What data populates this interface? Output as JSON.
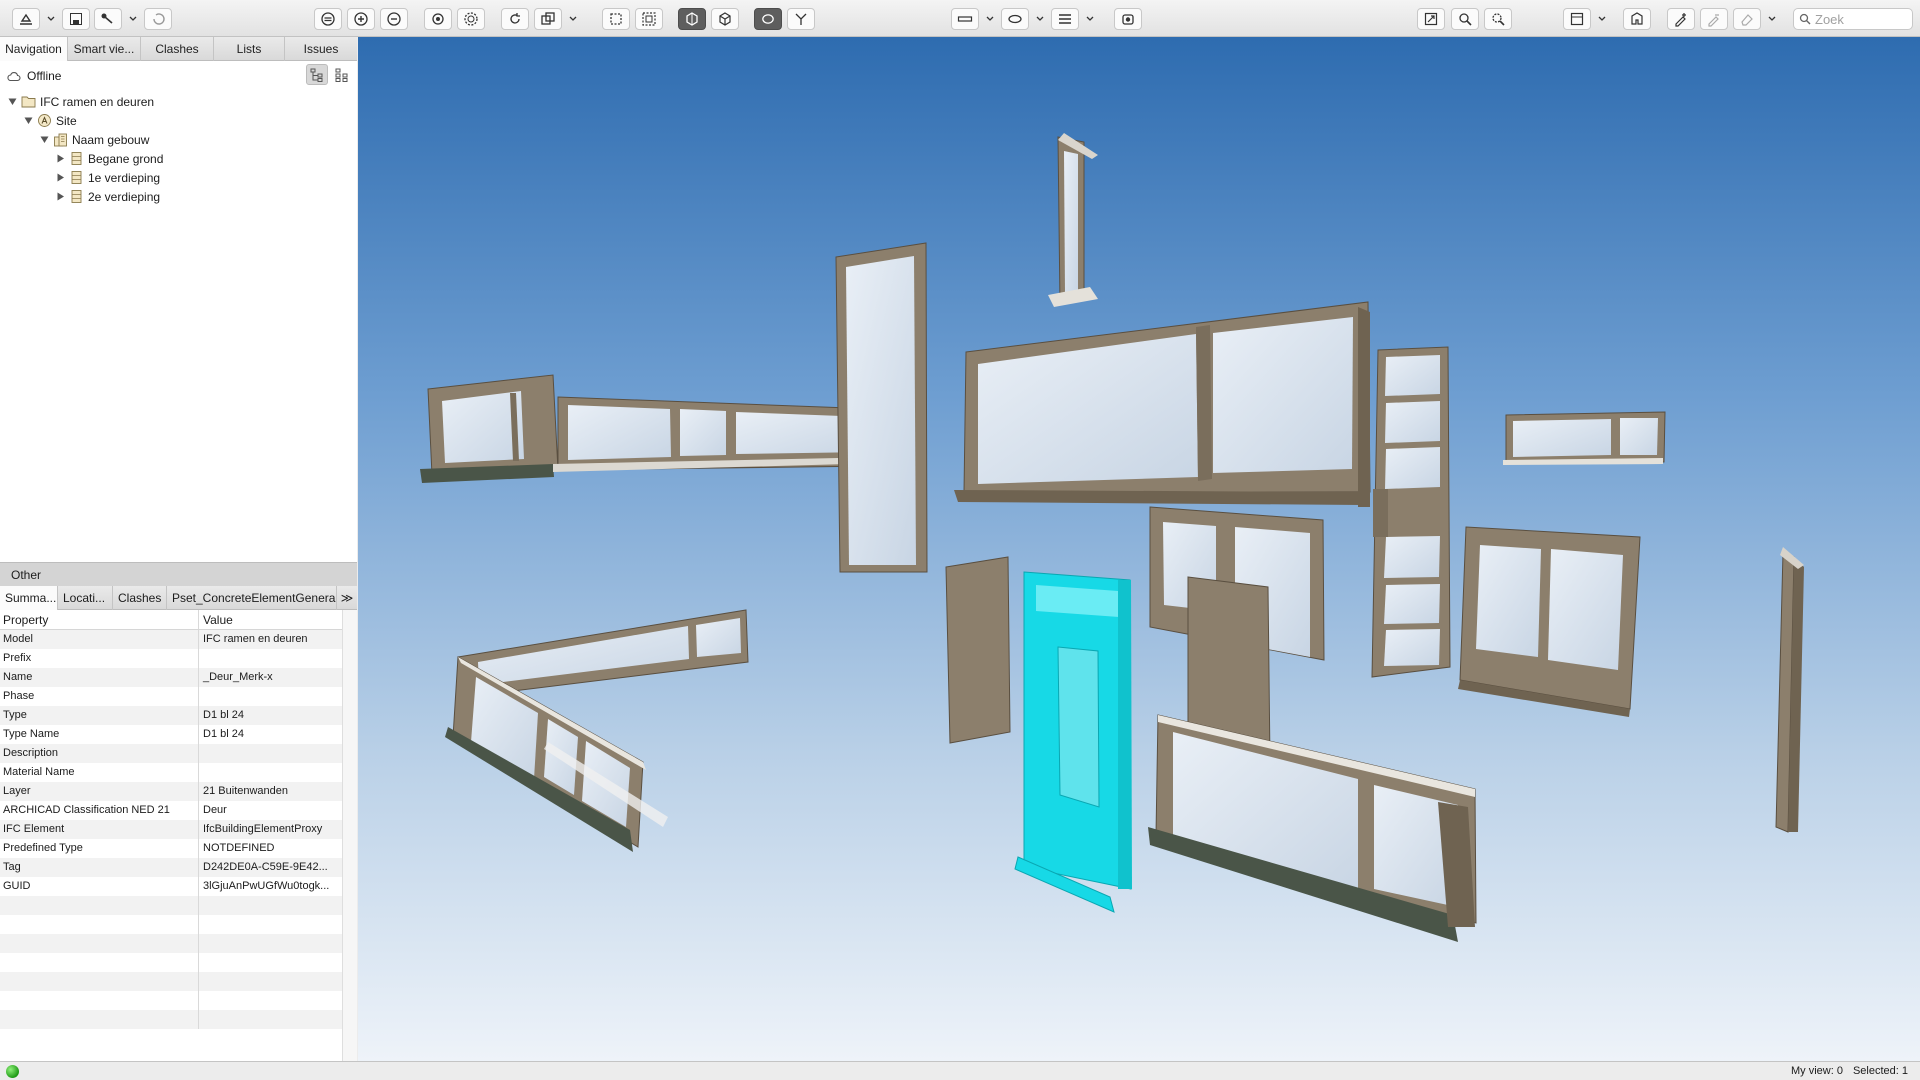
{
  "toolbar": {
    "search_placeholder": "Zoek",
    "buttons": [
      "open-icon",
      "save-icon",
      "measure-icon",
      "undo-icon",
      "hide-icon",
      "zoom-in-icon",
      "zoom-out-icon",
      "target-icon",
      "target-all-icon",
      "rotate-icon",
      "copy-icon",
      "frame-icon",
      "frames-icon",
      "section-box-icon",
      "cube-icon",
      "orbit-icon",
      "fly-icon",
      "ruler-icon",
      "ellipse-icon",
      "lines-icon",
      "camera-icon",
      "fit-icon",
      "zoom-selection-icon",
      "zoom-area-icon",
      "layout-icon",
      "plan-icon",
      "markup-add-icon",
      "markup-remove-icon",
      "eraser-icon"
    ]
  },
  "left_panel": {
    "tabs": [
      "Navigation",
      "Smart vie...",
      "Clashes",
      "Lists",
      "Issues"
    ],
    "status": "Offline",
    "tree": [
      {
        "label": "IFC ramen en deuren",
        "level": 0,
        "icon": "folder-icon"
      },
      {
        "label": "Site",
        "level": 1,
        "icon": "site-icon"
      },
      {
        "label": "Naam gebouw",
        "level": 2,
        "icon": "building-icon"
      },
      {
        "label": "Begane grond",
        "level": 3,
        "icon": "storey-icon"
      },
      {
        "label": "1e verdieping",
        "level": 3,
        "icon": "storey-icon"
      },
      {
        "label": "2e verdieping",
        "level": 3,
        "icon": "storey-icon"
      }
    ]
  },
  "properties": {
    "section_title": "Other",
    "tabs": [
      "Summa...",
      "Locati...",
      "Clashes",
      "Pset_ConcreteElementGeneral"
    ],
    "more": "≫",
    "columns": [
      "Property",
      "Value"
    ],
    "rows": [
      [
        "Model",
        "IFC ramen en deuren"
      ],
      [
        "Prefix",
        ""
      ],
      [
        "Name",
        "_Deur_Merk-x"
      ],
      [
        "Phase",
        ""
      ],
      [
        "Type",
        "D1 bl 24"
      ],
      [
        "Type Name",
        "D1 bl 24"
      ],
      [
        "Description",
        ""
      ],
      [
        "Material Name",
        ""
      ],
      [
        "Layer",
        "21 Buitenwanden"
      ],
      [
        "ARCHICAD Classification NED 21",
        "Deur"
      ],
      [
        "IFC Element",
        "IfcBuildingElementProxy"
      ],
      [
        "Predefined Type",
        "NOTDEFINED"
      ],
      [
        "Tag",
        "D242DE0A-C59E-9E42..."
      ],
      [
        "GUID",
        "3lGjuAnPwUGfWu0togk..."
      ],
      [
        "",
        ""
      ],
      [
        "",
        ""
      ],
      [
        "",
        ""
      ],
      [
        "",
        ""
      ],
      [
        "",
        ""
      ],
      [
        "",
        ""
      ],
      [
        "",
        ""
      ]
    ]
  },
  "statusbar": {
    "my_view": "My view: 0",
    "selected": "Selected: 1"
  },
  "colors": {
    "frame": "#8c7f6c",
    "frame_dark": "#6f6351",
    "glass": "#dfe8f2",
    "sill": "#4a5548",
    "selected": "#17d9e6",
    "sky_top": "#2e6cb0",
    "sky_bottom": "#eef3f9"
  }
}
